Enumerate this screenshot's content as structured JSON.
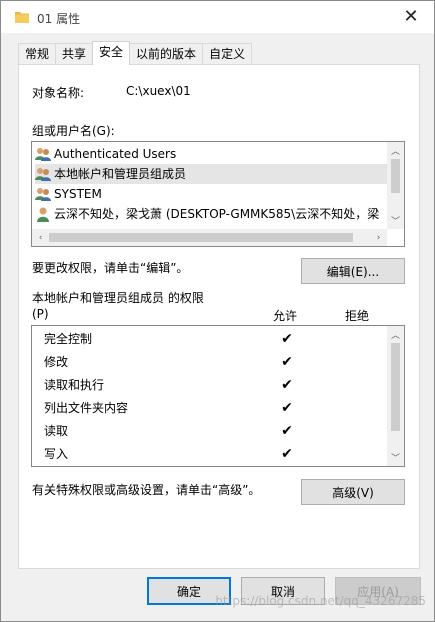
{
  "window": {
    "title": "01 属性"
  },
  "tabs": [
    {
      "label": "常规",
      "active": false
    },
    {
      "label": "共享",
      "active": false
    },
    {
      "label": "安全",
      "active": true
    },
    {
      "label": "以前的版本",
      "active": false
    },
    {
      "label": "自定义",
      "active": false
    }
  ],
  "security": {
    "object_label": "对象名称:",
    "object_value": "C:\\xuex\\01",
    "group_label": "组或用户名(G):",
    "users": [
      {
        "name": "Authenticated Users",
        "icon": "group-icon"
      },
      {
        "name": "本地帐户和管理员组成员",
        "icon": "group-icon"
      },
      {
        "name": "SYSTEM",
        "icon": "group-icon"
      },
      {
        "name": "云深不知处，梁戈萧 (DESKTOP-GMMK585\\云深不知处，梁",
        "icon": "user-icon"
      }
    ],
    "edit_hint": "要更改权限，请单击“编辑”。",
    "edit_button": "编辑(E)...",
    "perm_title": "本地帐户和管理员组成员 的权限",
    "perm_shortcut": "(P)",
    "allow_header": "允许",
    "deny_header": "拒绝",
    "permissions": [
      {
        "name": "完全控制",
        "allow": "✔",
        "deny": ""
      },
      {
        "name": "修改",
        "allow": "✔",
        "deny": ""
      },
      {
        "name": "读取和执行",
        "allow": "✔",
        "deny": ""
      },
      {
        "name": "列出文件夹内容",
        "allow": "✔",
        "deny": ""
      },
      {
        "name": "读取",
        "allow": "✔",
        "deny": ""
      },
      {
        "name": "写入",
        "allow": "✔",
        "deny": ""
      }
    ],
    "advanced_hint": "有关特殊权限或高级设置，请单击“高级”。",
    "advanced_button": "高级(V)"
  },
  "footer": {
    "ok": "确定",
    "cancel": "取消",
    "apply": "应用(A)"
  },
  "watermark": "https://blog.csdn.net/qq_43267285",
  "colors": {
    "accent": "#0078d7",
    "selected_row": "#e5e5e5"
  }
}
